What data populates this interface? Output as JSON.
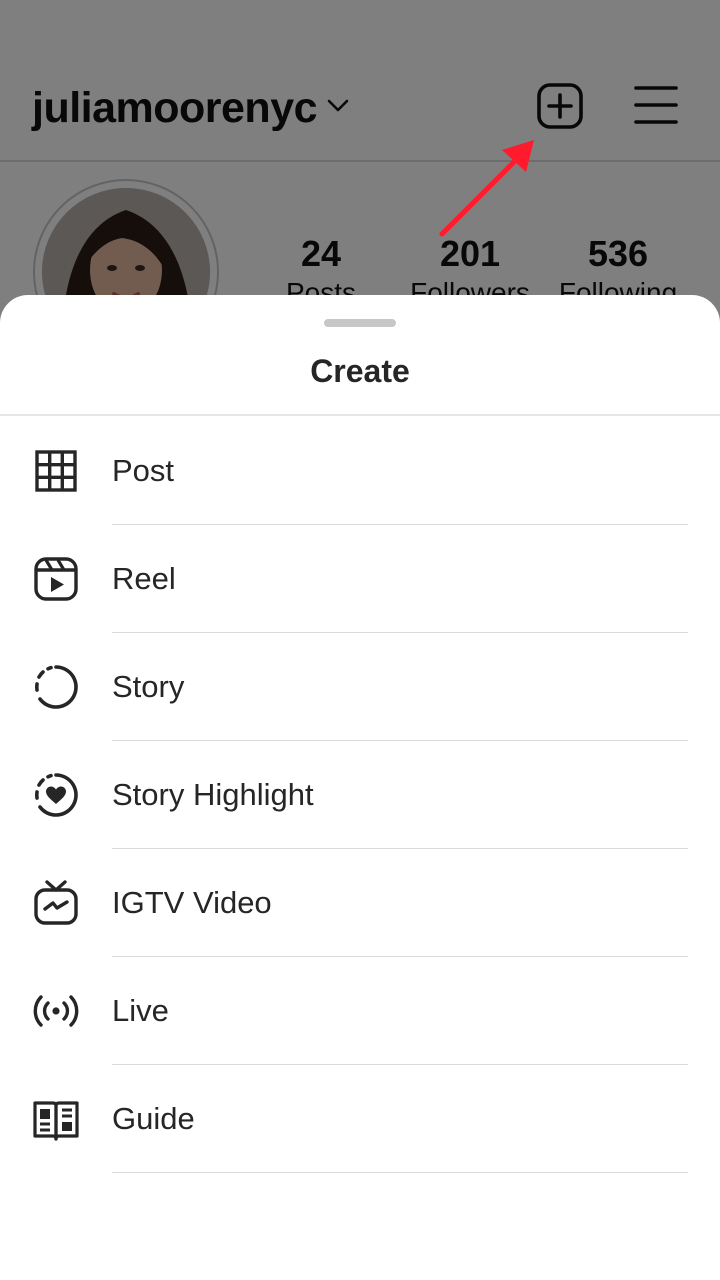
{
  "profile": {
    "username": "juliamoorenyc",
    "stats": [
      {
        "value": "24",
        "label": "Posts"
      },
      {
        "value": "201",
        "label": "Followers"
      },
      {
        "value": "536",
        "label": "Following"
      }
    ]
  },
  "sheet": {
    "title": "Create",
    "items": [
      {
        "label": "Post",
        "icon": "grid-icon"
      },
      {
        "label": "Reel",
        "icon": "reel-icon"
      },
      {
        "label": "Story",
        "icon": "story-icon"
      },
      {
        "label": "Story Highlight",
        "icon": "story-highlight-icon"
      },
      {
        "label": "IGTV Video",
        "icon": "igtv-icon"
      },
      {
        "label": "Live",
        "icon": "live-icon"
      },
      {
        "label": "Guide",
        "icon": "guide-icon"
      }
    ]
  },
  "colors": {
    "annotation_arrow": "#ff1a2e",
    "text": "#262626",
    "divider": "#dbdbdb"
  }
}
